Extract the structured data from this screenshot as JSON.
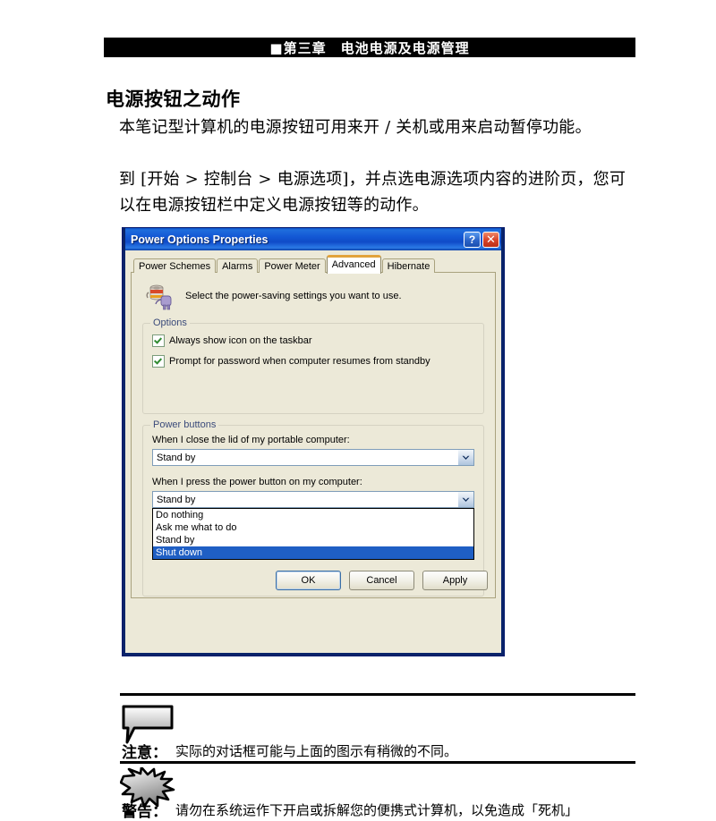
{
  "document": {
    "chapter_banner": "■第三章　电池电源及电源管理",
    "heading": "电源按钮之动作",
    "paragraph_1": "本笔记型计算机的电源按钮可用来开 / 关机或用来启动暂停功能。",
    "paragraph_2": "到 [开始 > 控制台 > 电源选项]，并点选电源选项内容的进阶页，您可以在电源按钮栏中定义电源按钮等的动作。"
  },
  "dialog": {
    "title": "Power Options Properties",
    "help_button": "?",
    "close_button": "✕",
    "tabs": [
      {
        "label": "Power Schemes",
        "active": false
      },
      {
        "label": "Alarms",
        "active": false
      },
      {
        "label": "Power Meter",
        "active": false
      },
      {
        "label": "Advanced",
        "active": true
      },
      {
        "label": "Hibernate",
        "active": false
      }
    ],
    "intro_text": "Select the power-saving settings you want to use.",
    "options_group": {
      "label": "Options",
      "checkboxes": [
        {
          "label": "Always show icon on the taskbar",
          "checked": true
        },
        {
          "label": "Prompt for password when computer resumes from standby",
          "checked": true
        }
      ]
    },
    "power_buttons_group": {
      "label": "Power buttons",
      "lid_label": "When I close the lid of my portable computer:",
      "lid_value": "Stand by",
      "power_label": "When I press the power button on my computer:",
      "power_value": "Stand by",
      "dropdown_options": [
        {
          "label": "Do nothing",
          "selected": false
        },
        {
          "label": "Ask me what to do",
          "selected": false
        },
        {
          "label": "Stand by",
          "selected": false
        },
        {
          "label": "Shut down",
          "selected": true
        }
      ]
    },
    "buttons": {
      "ok": "OK",
      "cancel": "Cancel",
      "apply": "Apply"
    }
  },
  "notes": [
    {
      "icon": "speech-bubble-icon",
      "label": "注意：",
      "text": "实际的对话框可能与上面的图示有稍微的不同。"
    },
    {
      "icon": "starburst-icon",
      "label": "警告：",
      "text": "请勿在系统运作下开启或拆解您的便携式计算机，以免造成「死机」"
    }
  ],
  "colors": {
    "title_bar_blue": "#0a51c8",
    "dialog_frame": "#0a246a",
    "dialog_face": "#ece9d8",
    "tab_active_accent": "#e2a33c",
    "selection_blue": "#1f5fc4",
    "checkmark_green": "#2f8a2f",
    "group_label_blue": "#3a4a7a"
  }
}
